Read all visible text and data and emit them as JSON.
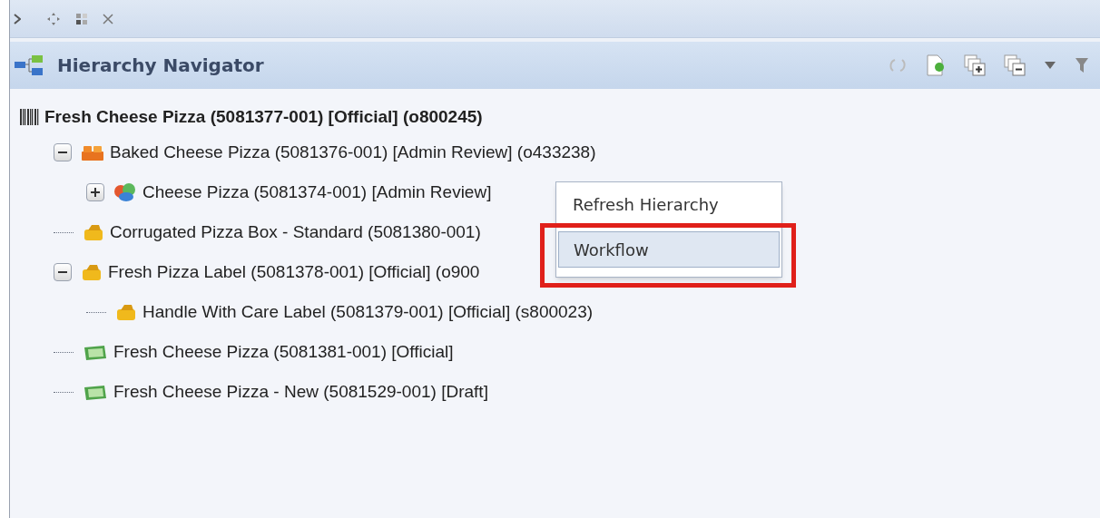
{
  "panel": {
    "title": "Hierarchy Navigator"
  },
  "tree": [
    {
      "label": "Fresh Cheese Pizza (5081377-001) [Official] (o800245)",
      "kind": "barcode",
      "bold": true,
      "children": [
        {
          "label": "Baked Cheese Pizza (5081376-001) [Admin Review] (o433238)",
          "kind": "bricks",
          "expanded": true,
          "children": [
            {
              "label": "Cheese Pizza (5081374-001) [Admin Review]",
              "kind": "group",
              "expanded": false
            }
          ]
        },
        {
          "label": "Corrugated Pizza Box - Standard (5081380-001)",
          "kind": "package"
        },
        {
          "label": "Fresh Pizza Label (5081378-001) [Official] (o900",
          "kind": "package",
          "expanded": true,
          "children": [
            {
              "label": "Handle With Care Label (5081379-001) [Official] (s800023)",
              "kind": "package"
            }
          ]
        },
        {
          "label": "Fresh Cheese Pizza (5081381-001) [Official]",
          "kind": "crate"
        },
        {
          "label": "Fresh Cheese Pizza - New (5081529-001) [Draft]",
          "kind": "crate"
        }
      ]
    }
  ],
  "context_menu": {
    "items": [
      {
        "label": "Refresh Hierarchy",
        "selected": false,
        "highlighted_box": false
      },
      {
        "label": "Workflow",
        "selected": true,
        "highlighted_box": true
      }
    ]
  }
}
